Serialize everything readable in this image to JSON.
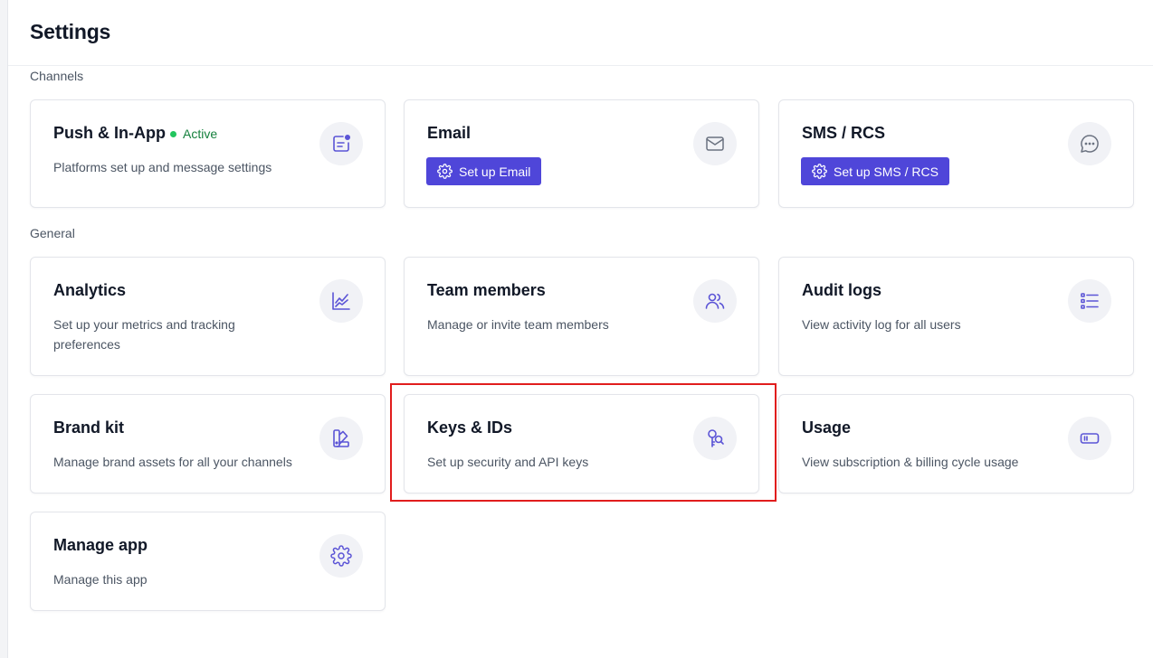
{
  "page": {
    "title": "Settings"
  },
  "sections": {
    "channels": "Channels",
    "general": "General"
  },
  "colors": {
    "accent": "#4f46d9",
    "active_green": "#22c55e",
    "highlight_red": "#e11d1d",
    "icon_stroke": "#5b54d6"
  },
  "cards": {
    "push": {
      "title": "Push & In-App",
      "status": "Active",
      "desc": "Platforms set up and message settings",
      "icon": "notification-icon"
    },
    "email": {
      "title": "Email",
      "button": "Set up Email",
      "icon": "mail-icon"
    },
    "sms": {
      "title": "SMS / RCS",
      "button": "Set up SMS / RCS",
      "icon": "chat-bubble-icon"
    },
    "analytics": {
      "title": "Analytics",
      "desc": "Set up your metrics and tracking preferences",
      "icon": "line-chart-icon"
    },
    "team": {
      "title": "Team members",
      "desc": "Manage or invite team members",
      "icon": "users-icon"
    },
    "audit": {
      "title": "Audit logs",
      "desc": "View activity log for all users",
      "icon": "list-icon"
    },
    "brand": {
      "title": "Brand kit",
      "desc": "Manage brand assets for all your channels",
      "icon": "palette-icon"
    },
    "keys": {
      "title": "Keys & IDs",
      "desc": "Set up security and API keys",
      "icon": "key-search-icon"
    },
    "usage": {
      "title": "Usage",
      "desc": "View subscription & billing cycle usage",
      "icon": "meter-icon"
    },
    "manage": {
      "title": "Manage app",
      "desc": "Manage this app",
      "icon": "gear-icon"
    }
  }
}
